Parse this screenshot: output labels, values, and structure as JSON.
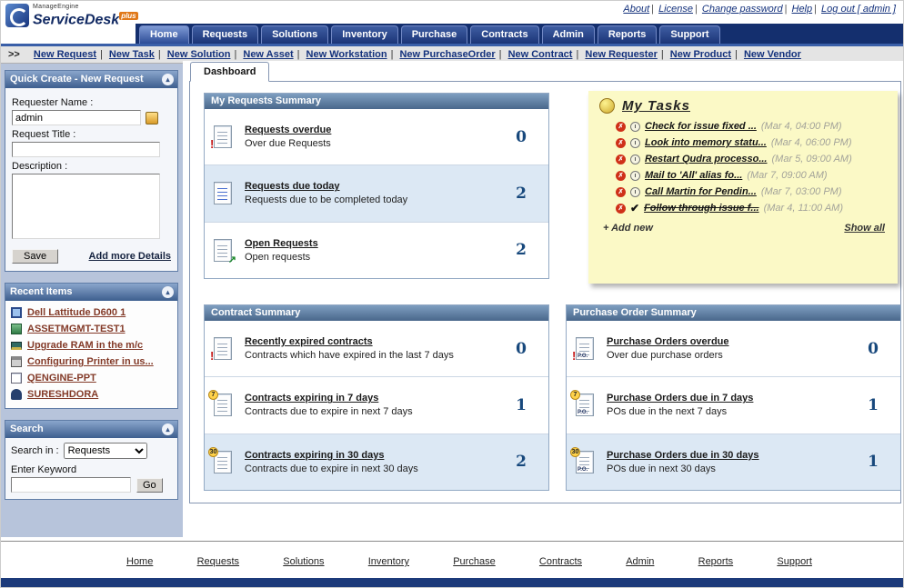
{
  "icons": {
    "collapse": "▴",
    "alert_badge": "!",
    "due7_badge": "7",
    "due30_badge": "30",
    "open_badge": "↗",
    "po_label": "P.O.",
    "x_mark": "✗",
    "check_mark": "✔"
  },
  "header": {
    "brand_top": "ManageEngine",
    "brand_main": "ServiceDesk",
    "brand_plus": "plus",
    "separator": "|",
    "links": [
      "About",
      "License",
      "Change password",
      "Help",
      "Log out [ admin ]"
    ]
  },
  "tabs": [
    "Home",
    "Requests",
    "Solutions",
    "Inventory",
    "Purchase",
    "Contracts",
    "Admin",
    "Reports",
    "Support"
  ],
  "quickbar": {
    "prefix": ">>",
    "separator": "|",
    "links": [
      "New Request",
      "New Task",
      "New Solution",
      "New Asset",
      "New Workstation",
      "New PurchaseOrder",
      "New Contract",
      "New Requester",
      "New Product",
      "New Vendor"
    ]
  },
  "sidebar": {
    "quick_create": {
      "title": "Quick Create - New Request",
      "requester_label": "Requester Name :",
      "requester_value": "admin",
      "title_label": "Request Title :",
      "description_label": "Description :",
      "save_label": "Save",
      "add_more_label": "Add more Details"
    },
    "recent_items": {
      "title": "Recent Items",
      "items": [
        "Dell Lattitude D600 1",
        "ASSETMGMT-TEST1",
        "Upgrade RAM in the m/c",
        "Configuring Printer in us...",
        "QENGINE-PPT",
        "SURESHDORA"
      ]
    },
    "search": {
      "title": "Search",
      "search_in_label": "Search in :",
      "search_in_value": "Requests",
      "keyword_label": "Enter Keyword",
      "go_label": "Go"
    }
  },
  "main": {
    "dashboard_tab": "Dashboard",
    "panels": [
      {
        "title": "My Requests Summary",
        "rows": [
          {
            "link": "Requests overdue",
            "desc": "Over due Requests",
            "count": "0"
          },
          {
            "link": "Requests due today",
            "desc": "Requests due to be completed today",
            "count": "2"
          },
          {
            "link": "Open Requests",
            "desc": "Open requests",
            "count": "2"
          }
        ]
      },
      {
        "title": "Contract Summary",
        "rows": [
          {
            "link": "Recently expired contracts",
            "desc": "Contracts which have expired in the last 7 days",
            "count": "0"
          },
          {
            "link": "Contracts expiring in 7 days",
            "desc": "Contracts due to expire in next 7 days",
            "count": "1"
          },
          {
            "link": "Contracts expiring in 30 days",
            "desc": "Contracts due to expire in next 30 days",
            "count": "2"
          }
        ]
      },
      {
        "title": "Purchase Order Summary",
        "rows": [
          {
            "link": "Purchase Orders overdue",
            "desc": "Over due purchase orders",
            "count": "0"
          },
          {
            "link": "Purchase Orders due in 7 days",
            "desc": "POs due in the next 7 days",
            "count": "1"
          },
          {
            "link": "Purchase Orders due in 30 days",
            "desc": "POs due in next 30 days",
            "count": "1"
          }
        ]
      }
    ],
    "tasks": {
      "title": "My Tasks",
      "items": [
        {
          "text": "Check for issue fixed ...",
          "time": "(Mar 4, 04:00 PM)"
        },
        {
          "text": "Look into memory statu...",
          "time": "(Mar 4, 06:00 PM)"
        },
        {
          "text": "Restart Qudra processo...",
          "time": "(Mar 5, 09:00 AM)"
        },
        {
          "text": "Mail to 'All' alias fo...",
          "time": "(Mar 7, 09:00 AM)"
        },
        {
          "text": "Call Martin for Pendin...",
          "time": "(Mar 7, 03:00 PM)"
        },
        {
          "text": "Follow through issue f...",
          "time": "(Mar 4, 11:00 AM)"
        }
      ],
      "add_new": "+ Add new",
      "show_all": "Show all"
    }
  },
  "footer": {
    "links": [
      "Home",
      "Requests",
      "Solutions",
      "Inventory",
      "Purchase",
      "Contracts",
      "Admin",
      "Reports",
      "Support"
    ]
  }
}
